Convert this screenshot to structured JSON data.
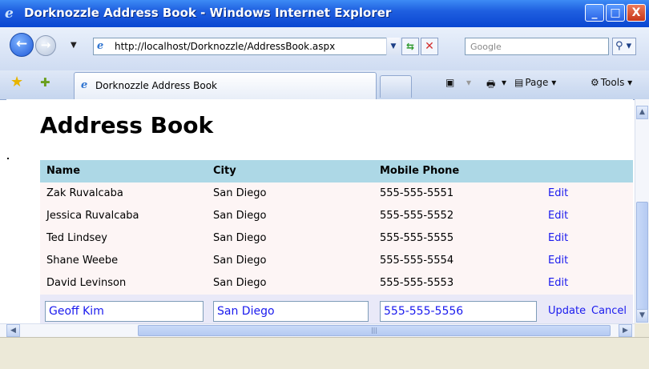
{
  "window": {
    "title": "Dorknozzle Address Book - Windows Internet Explorer",
    "minimize": "_",
    "maximize": "□",
    "close": "X"
  },
  "toolbar": {
    "url": "http://localhost/Dorknozzle/AddressBook.aspx",
    "search_placeholder": "Google",
    "tab_label": "Dorknozzle Address Book",
    "page_label": "Page",
    "tools_label": "Tools"
  },
  "page": {
    "heading": "Address Book"
  },
  "grid": {
    "headers": {
      "name": "Name",
      "city": "City",
      "phone": "Mobile Phone"
    },
    "rows": [
      {
        "name": "Zak Ruvalcaba",
        "city": "San Diego",
        "phone": "555-555-5551",
        "action": "Edit"
      },
      {
        "name": "Jessica Ruvalcaba",
        "city": "San Diego",
        "phone": "555-555-5552",
        "action": "Edit"
      },
      {
        "name": "Ted Lindsey",
        "city": "San Diego",
        "phone": "555-555-5555",
        "action": "Edit"
      },
      {
        "name": "Shane Weebe",
        "city": "San Diego",
        "phone": "555-555-5554",
        "action": "Edit"
      },
      {
        "name": "David Levinson",
        "city": "San Diego",
        "phone": "555-555-5553",
        "action": "Edit"
      }
    ],
    "edit_row": {
      "name": "Geoff Kim",
      "city": "San Diego",
      "phone": "555-555-5556",
      "update": "Update",
      "cancel": "Cancel"
    }
  },
  "colors": {
    "header_bg": "#add8e6",
    "row_bg": "#fdf5f5",
    "edit_row_bg": "#e9e9f8",
    "link": "#1a1aee"
  }
}
